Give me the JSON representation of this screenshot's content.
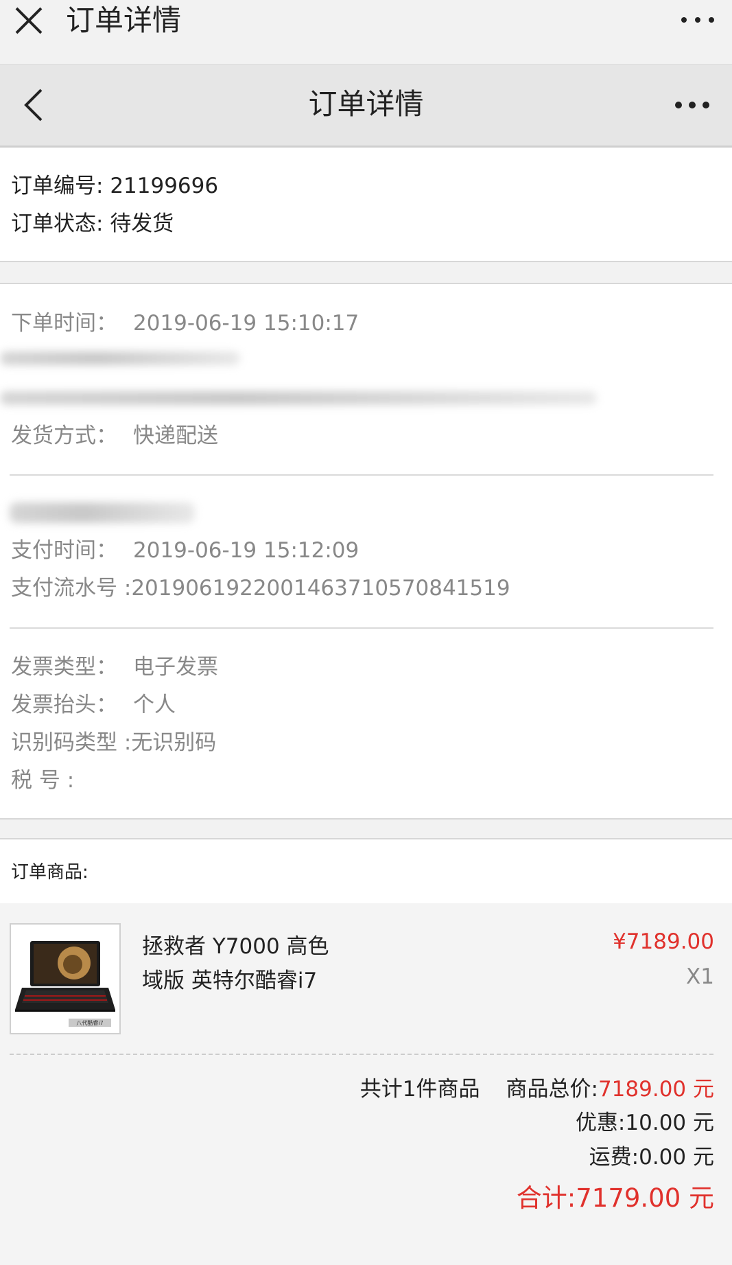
{
  "topbar": {
    "title": "订单详情",
    "close_icon": "close-icon",
    "more_icon": "more-dots-icon"
  },
  "navbar": {
    "title": "订单详情",
    "back_icon": "chevron-left-icon",
    "more_icon": "more-dots-icon"
  },
  "order": {
    "number_label": "订单编号",
    "number_value": "21199696",
    "status_label": "订单状态",
    "status_value": "待发货"
  },
  "details": {
    "order_time_label": "下单时间：",
    "order_time_value": "2019-06-19 15:10:17",
    "shipping_label": "发货方式：",
    "shipping_value": "快递配送",
    "pay_time_label": "支付时间：",
    "pay_time_value": "2019-06-19 15:12:09",
    "pay_serial_label": "支付流水号 :",
    "pay_serial_value": "2019061922001463710570841519",
    "invoice_type_label": "发票类型：",
    "invoice_type_value": "电子发票",
    "invoice_title_label": "发票抬头：",
    "invoice_title_value": "个人",
    "id_code_type_label": "识别码类型 :",
    "id_code_type_value": "无识别码",
    "tax_no_label": "税 号 :",
    "tax_no_value": ""
  },
  "goods": {
    "section_label": "订单商品:",
    "items": [
      {
        "name": "拯救者 Y7000 高色域版 英特尔酷睿i7",
        "price": "¥7189.00",
        "qty": "X1",
        "thumb_caption": "八代酷睿i7"
      }
    ]
  },
  "summary": {
    "count_text": "共计1件商品",
    "subtotal_label": "商品总价:",
    "subtotal_value": "7189.00 元",
    "discount_label": "优惠:",
    "discount_value": "10.00 元",
    "shipping_label": "运费:",
    "shipping_value": "0.00 元",
    "total_label": "合计:",
    "total_value": "7179.00 元"
  },
  "colors": {
    "accent_red": "#e0312c",
    "muted": "#888888"
  }
}
